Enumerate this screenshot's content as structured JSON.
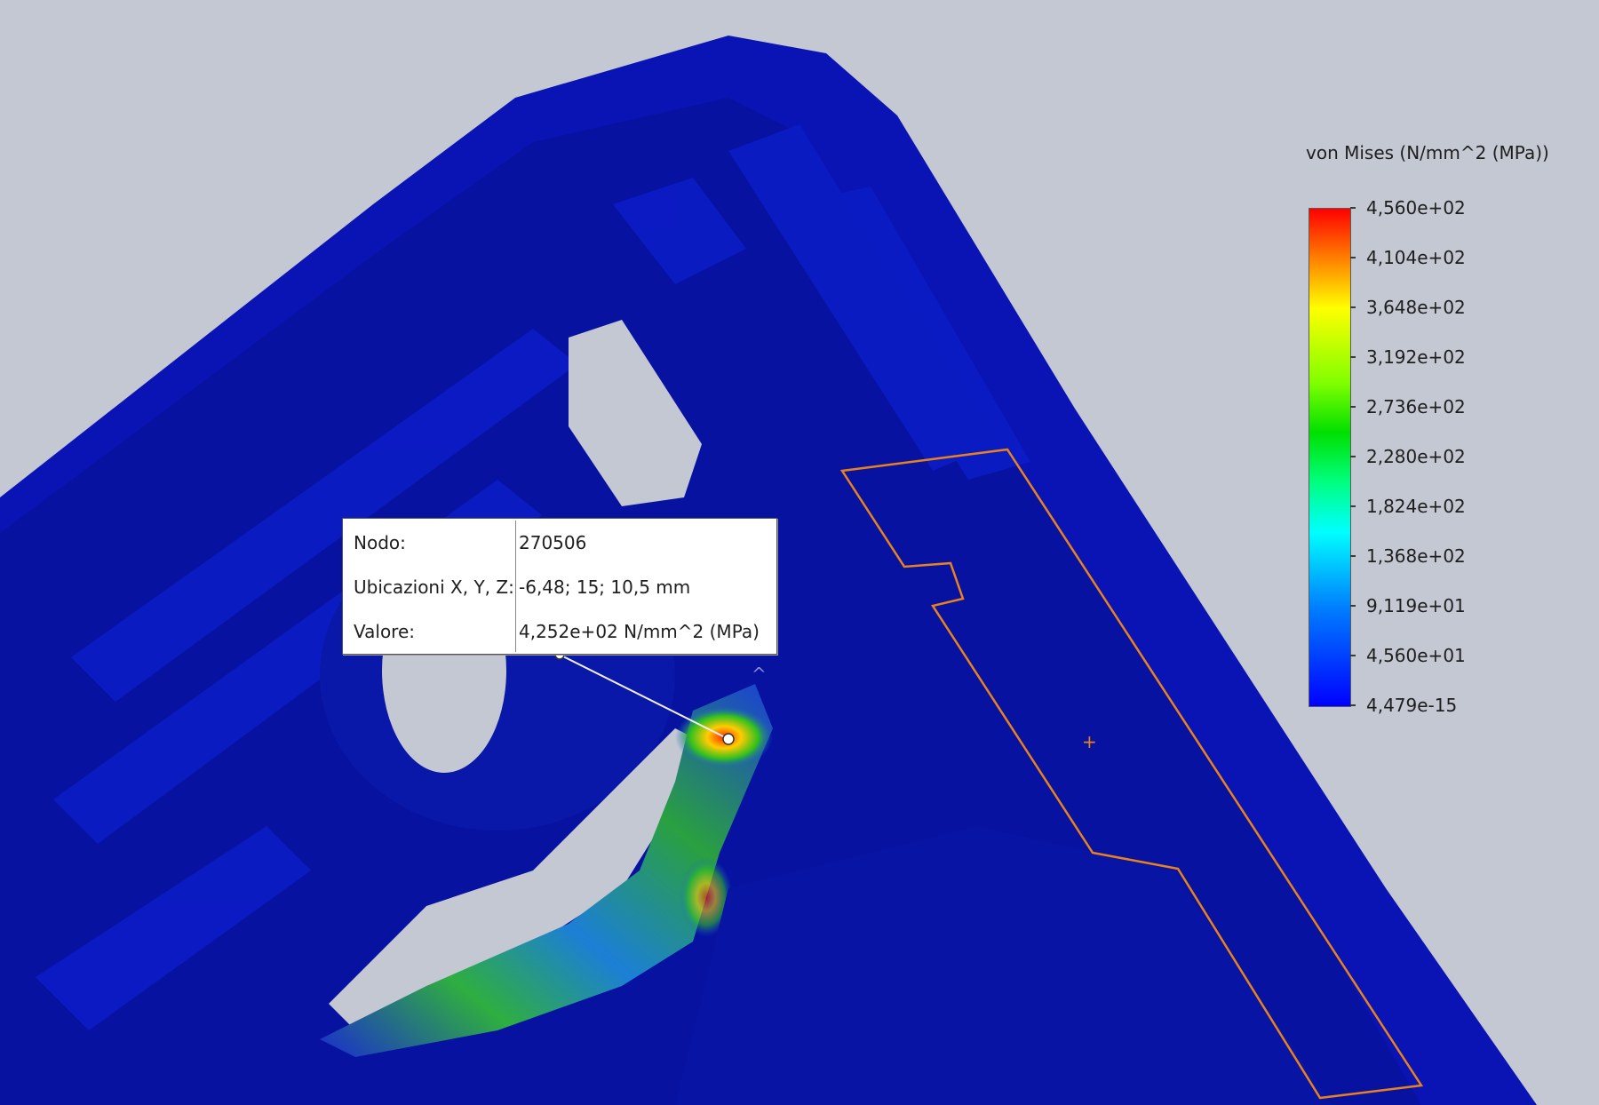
{
  "probe": {
    "rows": [
      {
        "label": "Nodo:",
        "value": "270506"
      },
      {
        "label": "Ubicazioni X, Y, Z:",
        "value": "-6,48; 15; 10,5 mm"
      },
      {
        "label": "Valore:",
        "value": "4,252e+02 N/mm^2 (MPa)"
      }
    ]
  },
  "legend": {
    "title": "von Mises (N/mm^2 (MPa))",
    "ticks": [
      "4,560e+02",
      "4,104e+02",
      "3,648e+02",
      "3,192e+02",
      "2,736e+02",
      "2,280e+02",
      "1,824e+02",
      "1,368e+02",
      "9,119e+01",
      "4,560e+01",
      "4,479e-15"
    ],
    "colors": {
      "max": "#ff0000",
      "min": "#0000ff"
    }
  },
  "colors": {
    "background": "#c3c8d2",
    "part": "#0a14b4",
    "selection_outline": "#e8821e"
  }
}
